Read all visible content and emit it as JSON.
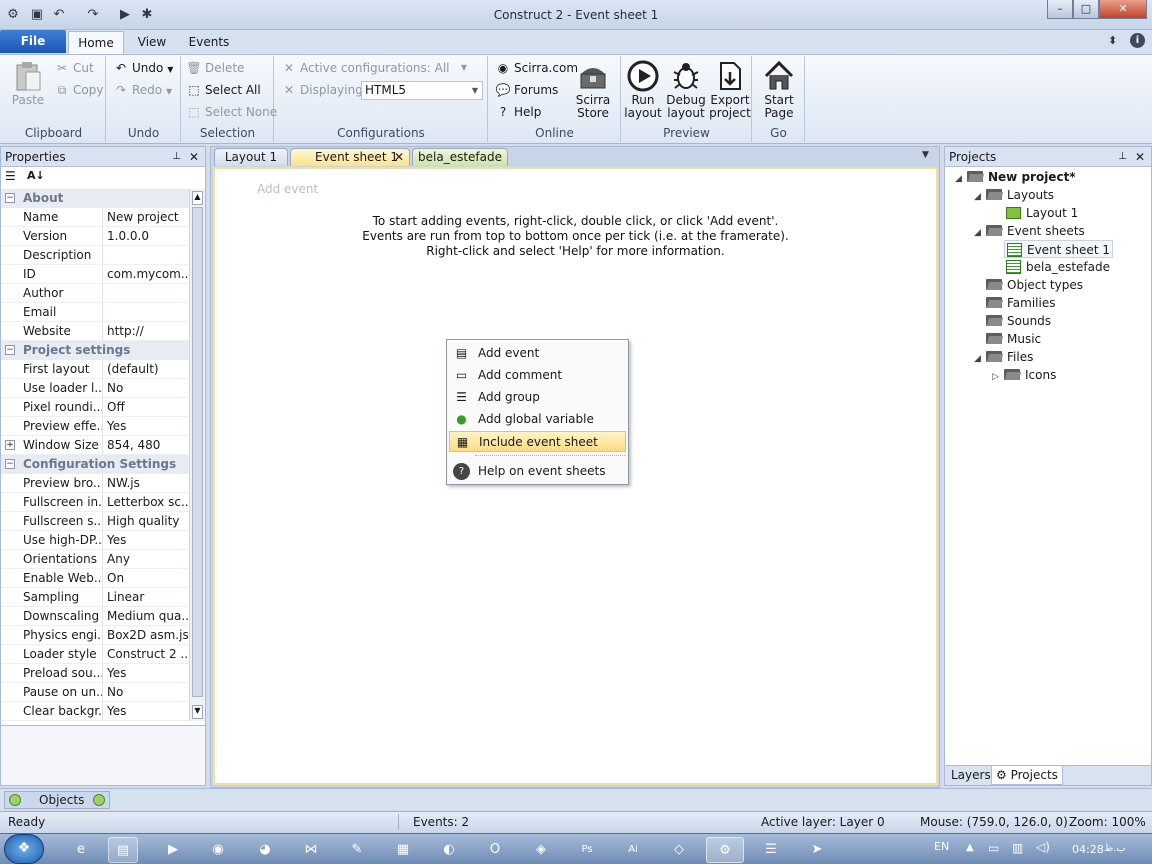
{
  "window": {
    "title": "Construct 2 - Event sheet 1",
    "controls": {
      "minimize": "–",
      "maximize": "□",
      "close": "✕"
    }
  },
  "quick_access": {
    "save_icon": "save-icon",
    "undo_icon": "undo-icon",
    "redo_icon": "redo-icon",
    "run_icon": "run-icon",
    "debug_icon": "debug-icon"
  },
  "ribbon_tabs": {
    "file": "File",
    "home": "Home",
    "view": "View",
    "events": "Events"
  },
  "clipboard": {
    "paste": "Paste",
    "cut": "Cut",
    "copy": "Copy",
    "label": "Clipboard"
  },
  "undo_group": {
    "undo": "Undo",
    "redo": "Redo",
    "label": "Undo"
  },
  "selection": {
    "delete": "Delete",
    "select_all": "Select All",
    "select_none": "Select None",
    "label": "Selection"
  },
  "configurations": {
    "active": "Active configurations: All",
    "displaying_label": "Displaying:",
    "displaying_value": "HTML5",
    "label": "Configurations"
  },
  "online": {
    "scirra": "Scirra.com",
    "forums": "Forums",
    "help": "Help",
    "store_line1": "Scirra",
    "store_line2": "Store",
    "label": "Online"
  },
  "preview": {
    "run_l1": "Run",
    "run_l2": "layout",
    "debug_l1": "Debug",
    "debug_l2": "layout",
    "export_l1": "Export",
    "export_l2": "project",
    "label": "Preview"
  },
  "go": {
    "start_l1": "Start",
    "start_l2": "Page",
    "label": "Go"
  },
  "properties": {
    "title": "Properties",
    "rows": [
      {
        "type": "cat",
        "key": "About"
      },
      {
        "key": "Name",
        "value": "New project"
      },
      {
        "key": "Version",
        "value": "1.0.0.0"
      },
      {
        "key": "Description",
        "value": ""
      },
      {
        "key": "ID",
        "value": "com.mycom..."
      },
      {
        "key": "Author",
        "value": ""
      },
      {
        "key": "Email",
        "value": ""
      },
      {
        "key": "Website",
        "value": "http://"
      },
      {
        "type": "cat",
        "key": "Project settings"
      },
      {
        "key": "First layout",
        "value": "(default)"
      },
      {
        "key": "Use loader l...",
        "value": "No"
      },
      {
        "key": "Pixel roundi...",
        "value": "Off"
      },
      {
        "key": "Preview effe...",
        "value": "Yes"
      },
      {
        "key": "Window Size",
        "value": "854, 480",
        "expand": "+"
      },
      {
        "type": "cat",
        "key": "Configuration Settings"
      },
      {
        "key": "Preview bro...",
        "value": "NW.js"
      },
      {
        "key": "Fullscreen in...",
        "value": "Letterbox sc..."
      },
      {
        "key": "Fullscreen s...",
        "value": "High quality"
      },
      {
        "key": "Use high-DP...",
        "value": "Yes"
      },
      {
        "key": "Orientations",
        "value": "Any"
      },
      {
        "key": "Enable Web...",
        "value": "On"
      },
      {
        "key": "Sampling",
        "value": "Linear"
      },
      {
        "key": "Downscaling",
        "value": "Medium qua..."
      },
      {
        "key": "Physics engi...",
        "value": "Box2D asm.js"
      },
      {
        "key": "Loader style",
        "value": "Construct 2 ..."
      },
      {
        "key": "Preload sou...",
        "value": "Yes"
      },
      {
        "key": "Pause on un...",
        "value": "No"
      },
      {
        "key": "Clear backgr...",
        "value": "Yes"
      }
    ]
  },
  "doc_tabs": [
    "Layout 1",
    "Event sheet 1",
    "bela_estefade"
  ],
  "sheet": {
    "add_event": "Add event",
    "msg1": "To start adding events, right-click, double click, or click 'Add event'.",
    "msg2": "Events are run from top to bottom once per tick (i.e. at the framerate).",
    "msg3": "Right-click and select 'Help' for more information."
  },
  "context_menu": {
    "items": [
      "Add event",
      "Add comment",
      "Add group",
      "Add global variable",
      "Include event sheet",
      "Help on event sheets"
    ]
  },
  "projects": {
    "title": "Projects",
    "root": "New project*",
    "layouts": "Layouts",
    "layout1": "Layout 1",
    "event_sheets": "Event sheets",
    "event_sheet1": "Event sheet 1",
    "bela": "bela_estefade",
    "object_types": "Object types",
    "families": "Families",
    "sounds": "Sounds",
    "music": "Music",
    "files": "Files",
    "icons": "Icons",
    "tab_layers": "Layers",
    "tab_projects": "Projects"
  },
  "objects_tab": "Objects",
  "status": {
    "ready": "Ready",
    "events": "Events: 2",
    "layer": "Active layer: Layer 0",
    "mouse": "Mouse: (759.0, 126.0, 0)",
    "zoom": "Zoom: 100%"
  },
  "taskbar": {
    "lang": "EN",
    "time": "04:28",
    "ampm": "ب.ظ"
  },
  "colors": {
    "accent": "#1c57b5",
    "highlight": "#fbdc82",
    "sheet_border": "#f2e19a"
  }
}
